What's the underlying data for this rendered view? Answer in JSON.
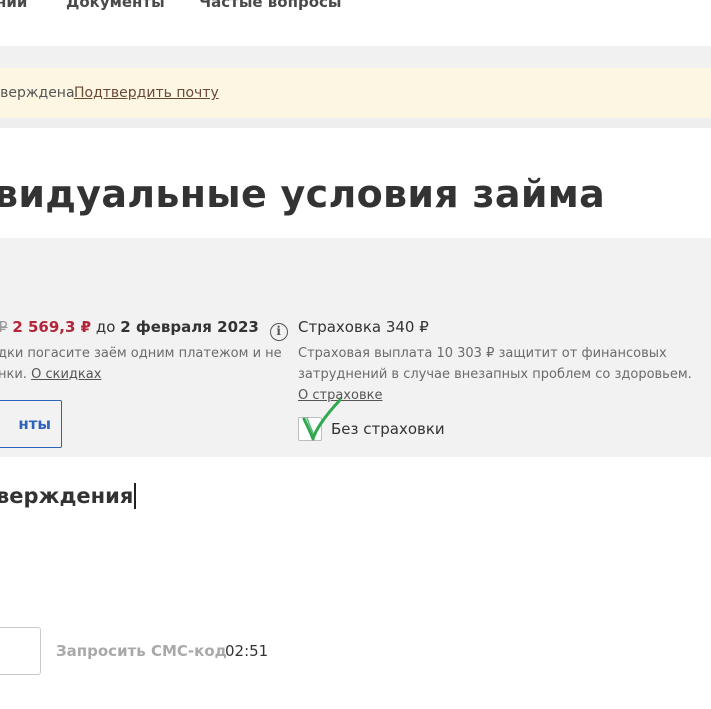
{
  "nav": {
    "items": [
      {
        "label": "ний"
      },
      {
        "label": "Документы"
      },
      {
        "label": "Частые вопросы"
      }
    ]
  },
  "banner": {
    "text": "тверждена",
    "link": "Подтвердить почту"
  },
  "page_title": "видуальные условия займа",
  "loan": {
    "old_price": "₽",
    "new_price": "2 569,3 ₽",
    "until": "до",
    "due_date": "2 февраля 2023",
    "info_icon": "info-icon",
    "discount_line1": "дки погасите заём одним платежом и не",
    "discount_line2": "нки.",
    "discount_link": "О скидках",
    "button_label": "нты"
  },
  "insurance": {
    "title": "Страховка 340 ₽",
    "desc_line1": "Страховая выплата 10 303 ₽ защитит от финансовых",
    "desc_line2": "затруднений в случае внезапных проблем со здоровьем.",
    "link": "О страховке",
    "checkbox_label": "Без страховки",
    "checked": true,
    "check_color": "#2fa84f"
  },
  "confirm": {
    "heading": "верждения",
    "code_value": "",
    "sms_button": "Запросить СМС-код",
    "timer": "02:51"
  }
}
